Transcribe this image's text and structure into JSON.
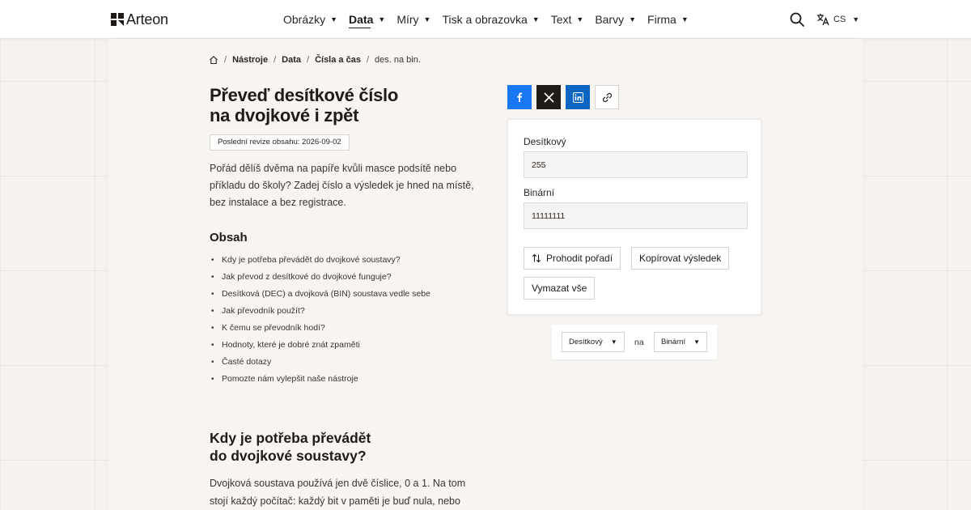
{
  "header": {
    "logo_text": "Arteon",
    "nav": [
      {
        "label": "Obrázky"
      },
      {
        "label": "Data"
      },
      {
        "label": "Míry"
      },
      {
        "label": "Tisk a obrazovka"
      },
      {
        "label": "Text"
      },
      {
        "label": "Barvy"
      },
      {
        "label": "Firma"
      }
    ],
    "active_nav": "Data",
    "language_code": "CS"
  },
  "breadcrumb": {
    "items": [
      "Nástroje",
      "Data",
      "Čísla a čas",
      "des. na bin."
    ]
  },
  "page": {
    "title_line1": "Převeď desítkové číslo",
    "title_line2": "na dvojkové i zpět",
    "revision": "Poslední revize obsahu: 2026-09-02",
    "intro": "Pořád dělíš dvěma na papíře kvůli masce podsítě nebo příkladu do školy? Zadej číslo a výsledek je hned na místě, bez instalace a bez registrace.",
    "toc_title": "Obsah",
    "toc": [
      "Kdy je potřeba převádět do dvojkové soustavy?",
      "Jak převod z desítkové do dvojkové funguje?",
      "Desítková (DEC) a dvojková (BIN) soustava vedle sebe",
      "Jak převodník použít?",
      "K čemu se převodník hodí?",
      "Hodnoty, které je dobré znát zpaměti",
      "Časté dotazy",
      "Pomozte nám vylepšit naše nástroje"
    ],
    "section_title_line1": "Kdy je potřeba převádět",
    "section_title_line2": "do dvojkové soustavy?",
    "section_text": "Dvojková soustava používá jen dvě číslice, 0 a 1. Na tom stojí každý počítač: každý bit v paměti je buď nula, nebo"
  },
  "share": {
    "icons": [
      "facebook-icon",
      "x-icon",
      "linkedin-icon",
      "link-icon"
    ]
  },
  "converter": {
    "decimal_label": "Desítkový",
    "decimal_value": "255",
    "binary_label": "Binární",
    "binary_value": "11111111",
    "swap_label": "Prohodit pořadí",
    "copy_label": "Kopírovat výsledek",
    "clear_label": "Vymazat vše"
  },
  "direction": {
    "from": "Desítkový",
    "to_word": "na",
    "to": "Binární"
  },
  "colors": {
    "facebook": "#1877f2",
    "x": "#1e1b19",
    "linkedin": "#0a66c2",
    "page_bg": "#f5f2ef"
  }
}
